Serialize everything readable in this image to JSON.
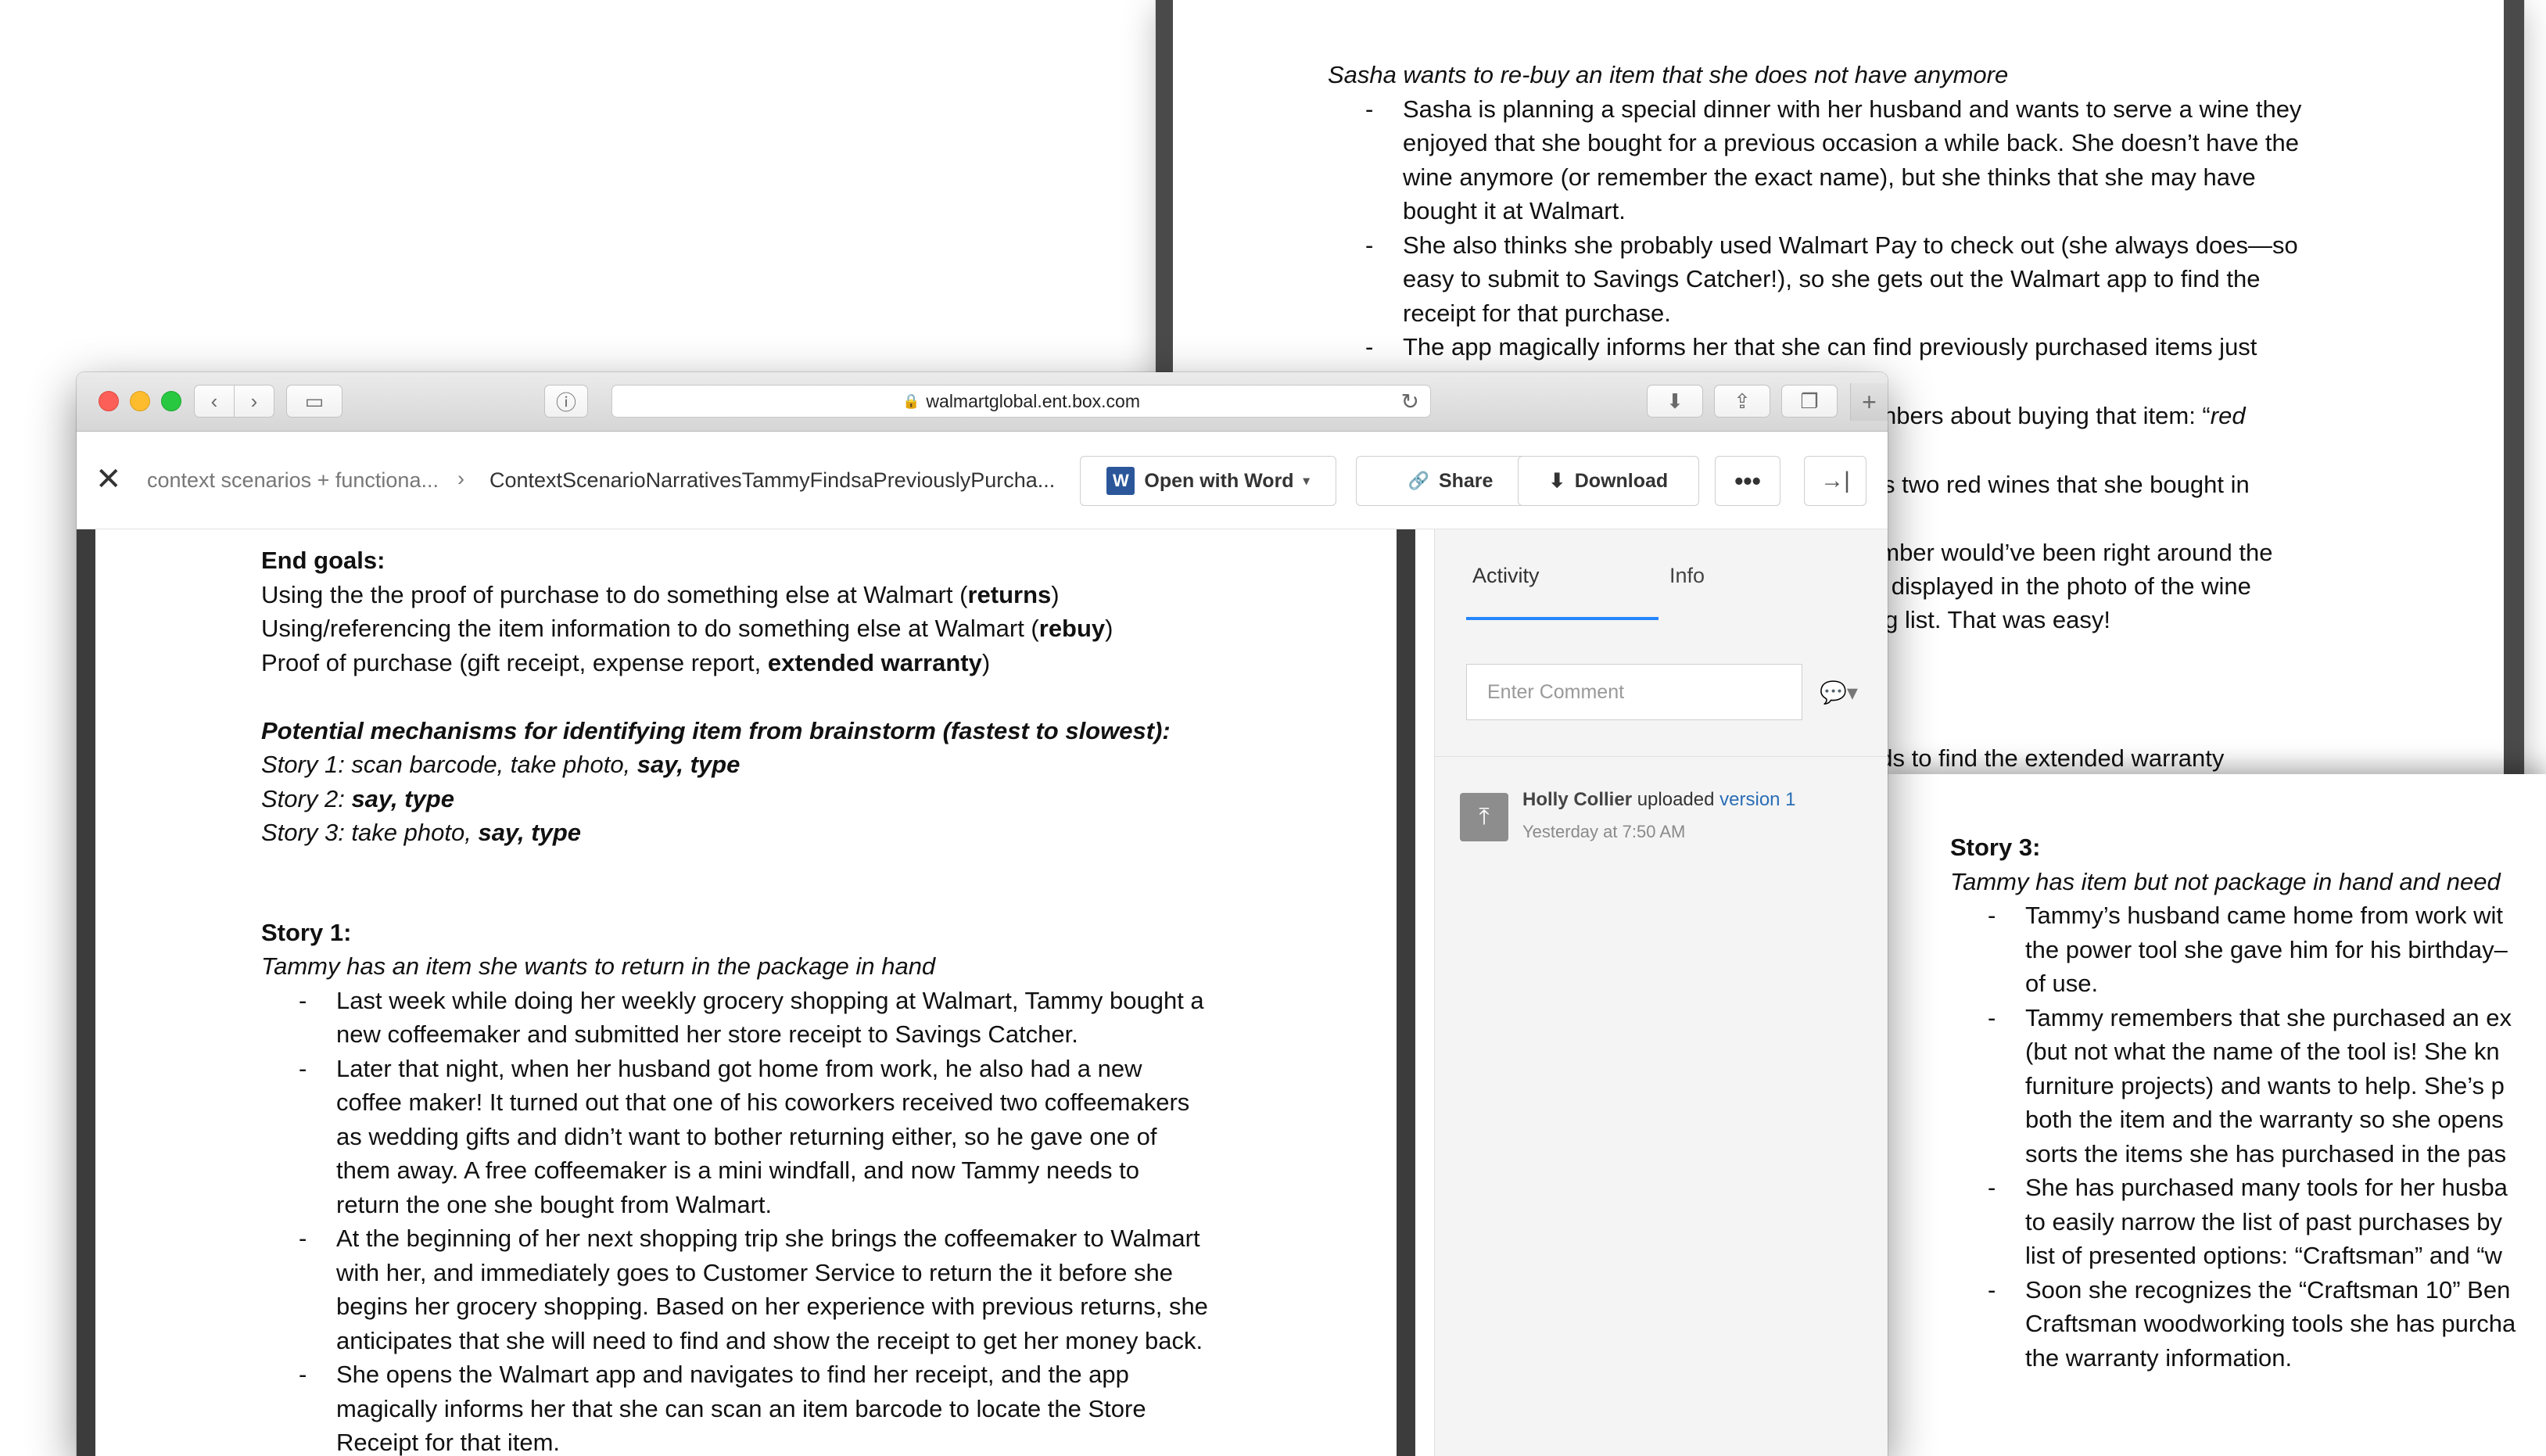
{
  "bg_top_doc": {
    "heading": "Sasha wants to re-buy an item that she does not have anymore",
    "bullets": [
      "Sasha is planning a special dinner with her husband and wants to serve a wine they enjoyed that she bought for a previous occasion a while back. She doesn’t have the wine anymore (or remember the exact name), but she thinks that she may have bought it at Walmart.",
      "She also thinks she probably used Walmart Pay to check out (she always does—so easy to submit to Savings Catcher!), so she gets out the Walmart app to find the receipt for that purchase.",
      "The app magically informs her that she can find previously purchased items just"
    ],
    "fragment_1_prefix": "nbers about buying that item: “",
    "fragment_1_italic": "red",
    "fragment_2": "s two red wines that she bought in",
    "fragment_3": "ember would’ve been right around the",
    "fragment_4": "el displayed in the photo of the wine",
    "fragment_5": "ing list. That was easy!",
    "fragment_6": "eds to find the extended warranty"
  },
  "bg_bottom_doc": {
    "title": "Story 3:",
    "subtitle": "Tammy has item but not package in hand and need",
    "bullets": [
      [
        "Tammy’s husband came home from work wit",
        "the power tool she gave him for his birthday–",
        "of use."
      ],
      [
        "Tammy remembers that she purchased an ex",
        "(but not what the name of the tool is! She kn",
        "furniture projects) and wants to help. She’s p",
        "both the item and the warranty so she opens",
        "sorts the items she has purchased in the pas"
      ],
      [
        "She has purchased many tools for her husba",
        "to easily narrow the list of past purchases by",
        "list of presented options: “Craftsman” and “w"
      ],
      [
        "Soon she recognizes the “Craftsman 10” Ben",
        "Craftsman woodworking tools she has purcha",
        "the warranty information."
      ]
    ]
  },
  "browser": {
    "url": "walmartglobal.ent.box.com",
    "icons": {
      "back": "‹",
      "forward": "›",
      "sidebar": "▭",
      "info": "ⓘ",
      "reload": "↻",
      "download": "⬇",
      "share": "⇪",
      "tabs": "❐",
      "new_tab": "+",
      "lock": "🔒"
    }
  },
  "box_header": {
    "close_icon": "✕",
    "breadcrumb_parent": "context scenarios + functiona...",
    "breadcrumb_sep": "›",
    "breadcrumb_current": "ContextScenarioNarrativesTammyFindsaPreviouslyPurcha...",
    "open_with_word": "Open with Word",
    "word_icon": "W",
    "caret": "▾",
    "share": "Share",
    "share_icon": "🔗",
    "download": "Download",
    "download_icon": "⬇",
    "more": "•••",
    "collapse_icon": "→|"
  },
  "document": {
    "end_goals_title": "End goals:",
    "goal_1_text": "Using the the proof of purchase to do something else at Walmart (",
    "goal_1_bold": "returns",
    "goal_1_end": ")",
    "goal_2_text": "Using/referencing the item information to do something else at Walmart (",
    "goal_2_bold": "rebuy",
    "goal_2_end": ")",
    "goal_3_text": "Proof of purchase (gift receipt, expense report, ",
    "goal_3_bold": "extended warranty",
    "goal_3_end": ")",
    "mechanisms_title": "Potential mechanisms for identifying item from brainstorm (fastest to slowest):",
    "story_1_mech_text": "Story 1: scan barcode, take photo, ",
    "story_1_mech_bold": "say, type",
    "story_2_mech_text": "Story 2: ",
    "story_2_mech_bold": "say, type",
    "story_3_mech_text": "Story 3: take photo, ",
    "story_3_mech_bold": "say, type",
    "story_1_title": "Story 1:",
    "story_1_subtitle": "Tammy has an item she wants to return in the package in hand",
    "story_1_bullets": [
      [
        "Last week while doing her weekly grocery shopping at Walmart, Tammy bought a",
        "new coffeemaker and submitted her store receipt to Savings Catcher."
      ],
      [
        "Later that night, when her husband got home from work, he also had a new",
        "coffee maker! It turned out that one of his coworkers received two coffeemakers",
        "as wedding gifts and didn’t want to bother returning either, so he gave one of",
        "them away. A free coffeemaker is a mini windfall, and now Tammy needs to",
        "return the one she bought from Walmart."
      ],
      [
        "At the beginning of her next shopping trip she brings the coffeemaker to Walmart",
        "with her, and immediately goes to Customer Service to return the it before she",
        "begins her grocery shopping. Based on her experience with previous returns, she",
        "anticipates that she will need to find and show the receipt to get her money back."
      ],
      [
        "She opens the Walmart app and navigates to find her receipt, and the app",
        "magically informs her that she can scan an item barcode to locate the Store",
        "Receipt for that item."
      ]
    ]
  },
  "sidebar": {
    "tab_activity": "Activity",
    "tab_info": "Info",
    "comment_placeholder": "Enter Comment",
    "comment_icon": "💬▾",
    "upload_icon": "⤒",
    "uploader": "Holly Collier",
    "uploaded_text": " uploaded ",
    "version_link": "version 1",
    "timestamp": "Yesterday at 7:50 AM"
  },
  "colors": {
    "accent_blue": "#2486fc",
    "link_blue": "#2a6db5",
    "word_blue": "#2b579a",
    "traffic_red": "#fc5f57",
    "traffic_yellow": "#fdbc2e",
    "traffic_green": "#28c840"
  }
}
